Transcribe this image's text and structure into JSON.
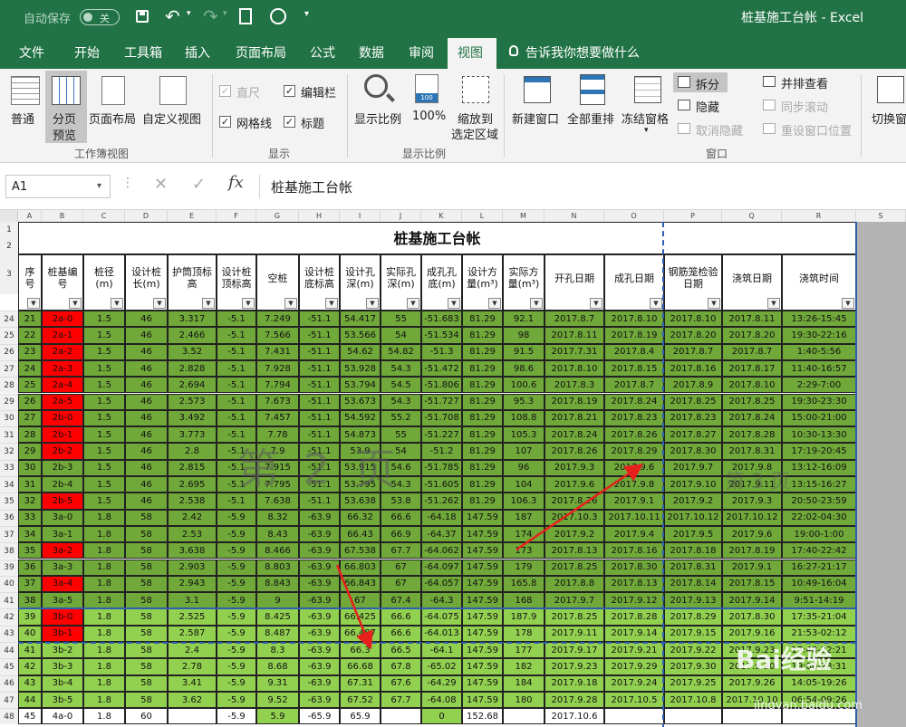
{
  "titlebar": {
    "autosave_label": "自动保存",
    "autosave_state": "关",
    "title": "桩基施工台帐 - Excel"
  },
  "tabs": [
    "文件",
    "开始",
    "工具箱",
    "插入",
    "页面布局",
    "公式",
    "数据",
    "审阅",
    "视图"
  ],
  "tell_me": "告诉我你想要做什么",
  "ribbon": {
    "normal": "普通",
    "page_break_1": "分页",
    "page_break_2": "预览",
    "page_layout": "页面布局",
    "custom_view": "自定义视图",
    "group_workbook_views": "工作簿视图",
    "ruler": "直尺",
    "formula_bar": "编辑栏",
    "gridlines": "网格线",
    "headings": "标题",
    "group_show": "显示",
    "zoom": "显示比例",
    "zoom100": "100%",
    "zoom_sel_1": "缩放到",
    "zoom_sel_2": "选定区域",
    "group_zoom": "显示比例",
    "new_window": "新建窗口",
    "arrange_all": "全部重排",
    "freeze": "冻结窗格",
    "split": "拆分",
    "hide": "隐藏",
    "unhide": "取消隐藏",
    "side_by_side": "并排查看",
    "sync_scroll": "同步滚动",
    "reset_pos": "重设窗口位置",
    "group_window": "窗口",
    "switch": "切换窗"
  },
  "formula": {
    "name_box": "A1",
    "content": "桩基施工台帐"
  },
  "colors": {
    "brand": "#217346",
    "dark_green": "#70a83a",
    "light_green": "#92d050",
    "red": "#ff0000"
  },
  "columns": [
    "A",
    "B",
    "C",
    "D",
    "E",
    "F",
    "G",
    "H",
    "I",
    "J",
    "K",
    "L",
    "M",
    "N",
    "O",
    "P",
    "Q",
    "R",
    "S"
  ],
  "sheet": {
    "title": "桩基施工台帐",
    "headers": [
      "序号",
      "桩基编号",
      "桩径(m)",
      "设计桩长(m)",
      "护筒顶标高",
      "设计桩顶标高",
      "空桩",
      "设计桩底标高",
      "设计孔深(m)",
      "实际孔深(m)",
      "成孔孔底(m)",
      "设计方量(m³)",
      "实际方量(m³)",
      "开孔日期",
      "成孔日期",
      "钢筋笼检验日期",
      "浇筑日期",
      "浇筑时间"
    ],
    "watermark_1": "第 2 页",
    "watermark_2": "第 3 页",
    "header_row_nums": [
      "1",
      "2",
      "3"
    ],
    "rows": [
      {
        "n": "24",
        "c": [
          "21",
          "2a-0",
          "1.5",
          "46",
          "3.317",
          "-5.1",
          "7.249",
          "-51.1",
          "54.417",
          "55",
          "-51.683",
          "81.29",
          "92.1",
          "2017.8.7",
          "2017.8.10",
          "2017.8.10",
          "2017.8.11",
          "13:26-15:45"
        ]
      },
      {
        "n": "25",
        "c": [
          "22",
          "2a-1",
          "1.5",
          "46",
          "2.466",
          "-5.1",
          "7.566",
          "-51.1",
          "53.566",
          "54",
          "-51.534",
          "81.29",
          "98",
          "2017.8.11",
          "2017.8.19",
          "2017.8.20",
          "2017.8.20",
          "19:30-22:16"
        ]
      },
      {
        "n": "26",
        "c": [
          "23",
          "2a-2",
          "1.5",
          "46",
          "3.52",
          "-5.1",
          "7.431",
          "-51.1",
          "54.62",
          "54.82",
          "-51.3",
          "81.29",
          "91.5",
          "2017.7.31",
          "2017.8.4",
          "2017.8.7",
          "2017.8.7",
          "1:40-5:56"
        ]
      },
      {
        "n": "27",
        "c": [
          "24",
          "2a-3",
          "1.5",
          "46",
          "2.828",
          "-5.1",
          "7.928",
          "-51.1",
          "53.928",
          "54.3",
          "-51.472",
          "81.29",
          "98.6",
          "2017.8.10",
          "2017.8.15",
          "2017.8.16",
          "2017.8.17",
          "11:40-16:57"
        ]
      },
      {
        "n": "28",
        "c": [
          "25",
          "2a-4",
          "1.5",
          "46",
          "2.694",
          "-5.1",
          "7.794",
          "-51.1",
          "53.794",
          "54.5",
          "-51.806",
          "81.29",
          "100.6",
          "2017.8.3",
          "2017.8.7",
          "2017.8.9",
          "2017.8.10",
          "2:29-7:00"
        ]
      },
      {
        "n": "29",
        "c": [
          "26",
          "2a-5",
          "1.5",
          "46",
          "2.573",
          "-5.1",
          "7.673",
          "-51.1",
          "53.673",
          "54.3",
          "-51.727",
          "81.29",
          "95.3",
          "2017.8.19",
          "2017.8.24",
          "2017.8.25",
          "2017.8.25",
          "19:30-23:30"
        ]
      },
      {
        "n": "30",
        "c": [
          "27",
          "2b-0",
          "1.5",
          "46",
          "3.492",
          "-5.1",
          "7.457",
          "-51.1",
          "54.592",
          "55.2",
          "-51.708",
          "81.29",
          "108.8",
          "2017.8.21",
          "2017.8.23",
          "2017.8.23",
          "2017.8.24",
          "15:00-21:00"
        ]
      },
      {
        "n": "31",
        "c": [
          "28",
          "2b-1",
          "1.5",
          "46",
          "3.773",
          "-5.1",
          "7.78",
          "-51.1",
          "54.873",
          "55",
          "-51.227",
          "81.29",
          "105.3",
          "2017.8.24",
          "2017.8.26",
          "2017.8.27",
          "2017.8.28",
          "10:30-13:30"
        ]
      },
      {
        "n": "32",
        "c": [
          "29",
          "2b-2",
          "1.5",
          "46",
          "2.8",
          "-5.1",
          "7.9",
          "-51.1",
          "53.9",
          "54",
          "-51.2",
          "81.29",
          "107",
          "2017.8.26",
          "2017.8.29",
          "2017.8.30",
          "2017.8.31",
          "17:19-20:45"
        ]
      },
      {
        "n": "33",
        "c": [
          "30",
          "2b-3",
          "1.5",
          "46",
          "2.815",
          "-5.1",
          "7.915",
          "-51.1",
          "53.915",
          "54.6",
          "-51.785",
          "81.29",
          "96",
          "2017.9.3",
          "2017.9.6",
          "2017.9.7",
          "2017.9.8",
          "13:12-16:09"
        ]
      },
      {
        "n": "34",
        "c": [
          "31",
          "2b-4",
          "1.5",
          "46",
          "2.695",
          "-5.1",
          "7.795",
          "-51.1",
          "53.795",
          "54.3",
          "-51.605",
          "81.29",
          "104",
          "2017.9.6",
          "2017.9.8",
          "2017.9.10",
          "2017.9.11",
          "13:15-16:27"
        ]
      },
      {
        "n": "35",
        "c": [
          "32",
          "2b-5",
          "1.5",
          "46",
          "2.538",
          "-5.1",
          "7.638",
          "-51.1",
          "53.638",
          "53.8",
          "-51.262",
          "81.29",
          "106.3",
          "2017.8.26",
          "2017.9.1",
          "2017.9.2",
          "2017.9.3",
          "20:50-23:59"
        ]
      },
      {
        "n": "36",
        "c": [
          "33",
          "3a-0",
          "1.8",
          "58",
          "2.42",
          "-5.9",
          "8.32",
          "-63.9",
          "66.32",
          "66.6",
          "-64.18",
          "147.59",
          "187",
          "2017.10.3",
          "2017.10.11",
          "2017.10.12",
          "2017.10.12",
          "22:02-04:30"
        ]
      },
      {
        "n": "37",
        "c": [
          "34",
          "3a-1",
          "1.8",
          "58",
          "2.53",
          "-5.9",
          "8.43",
          "-63.9",
          "66.43",
          "66.9",
          "-64.37",
          "147.59",
          "174",
          "2017.9.2",
          "2017.9.4",
          "2017.9.5",
          "2017.9.6",
          "19:00-1:00"
        ]
      },
      {
        "n": "38",
        "c": [
          "35",
          "3a-2",
          "1.8",
          "58",
          "3.638",
          "-5.9",
          "8.466",
          "-63.9",
          "67.538",
          "67.7",
          "-64.062",
          "147.59",
          "173",
          "2017.8.13",
          "2017.8.16",
          "2017.8.18",
          "2017.8.19",
          "17:40-22:42"
        ]
      },
      {
        "n": "39",
        "c": [
          "36",
          "3a-3",
          "1.8",
          "58",
          "2.903",
          "-5.9",
          "8.803",
          "-63.9",
          "66.803",
          "67",
          "-64.097",
          "147.59",
          "179",
          "2017.8.25",
          "2017.8.30",
          "2017.8.31",
          "2017.9.1",
          "16:27-21:17"
        ]
      },
      {
        "n": "40",
        "c": [
          "37",
          "3a-4",
          "1.8",
          "58",
          "2.943",
          "-5.9",
          "8.843",
          "-63.9",
          "66.843",
          "67",
          "-64.057",
          "147.59",
          "165.8",
          "2017.8.8",
          "2017.8.13",
          "2017.8.14",
          "2017.8.15",
          "10:49-16:04"
        ]
      },
      {
        "n": "41",
        "c": [
          "38",
          "3a-5",
          "1.8",
          "58",
          "3.1",
          "-5.9",
          "9",
          "-63.9",
          "67",
          "67.4",
          "-64.3",
          "147.59",
          "168",
          "2017.9.7",
          "2017.9.12",
          "2017.9.13",
          "2017.9.14",
          "9:51-14:19"
        ]
      },
      {
        "n": "42",
        "c": [
          "39",
          "3b-0",
          "1.8",
          "58",
          "2.525",
          "-5.9",
          "8.425",
          "-63.9",
          "66.425",
          "66.6",
          "-64.075",
          "147.59",
          "187.9",
          "2017.8.25",
          "2017.8.28",
          "2017.8.29",
          "2017.8.30",
          "17:35-21:04"
        ]
      },
      {
        "n": "43",
        "c": [
          "40",
          "3b-1",
          "1.8",
          "58",
          "2.587",
          "-5.9",
          "8.487",
          "-63.9",
          "66.487",
          "66.6",
          "-64.013",
          "147.59",
          "178",
          "2017.9.11",
          "2017.9.14",
          "2017.9.15",
          "2017.9.16",
          "21:53-02:12"
        ]
      },
      {
        "n": "44",
        "c": [
          "41",
          "3b-2",
          "1.8",
          "58",
          "2.4",
          "-5.9",
          "8.3",
          "-63.9",
          "66.3",
          "66.5",
          "-64.1",
          "147.59",
          "177",
          "2017.9.17",
          "2017.9.21",
          "2017.9.22",
          "2017.9.23",
          "17:48-22:21"
        ]
      },
      {
        "n": "45",
        "c": [
          "42",
          "3b-3",
          "1.8",
          "58",
          "2.78",
          "-5.9",
          "8.68",
          "-63.9",
          "66.68",
          "67.8",
          "-65.02",
          "147.59",
          "182",
          "2017.9.23",
          "2017.9.29",
          "2017.9.30",
          "2017.9.30",
          "19:00-23:31"
        ]
      },
      {
        "n": "46",
        "c": [
          "43",
          "3b-4",
          "1.8",
          "58",
          "3.41",
          "-5.9",
          "9.31",
          "-63.9",
          "67.31",
          "67.6",
          "-64.29",
          "147.59",
          "184",
          "2017.9.18",
          "2017.9.24",
          "2017.9.25",
          "2017.9.26",
          "14:05-19:26"
        ]
      },
      {
        "n": "47",
        "c": [
          "44",
          "3b-5",
          "1.8",
          "58",
          "3.62",
          "-5.9",
          "9.52",
          "-63.9",
          "67.52",
          "67.7",
          "-64.08",
          "147.59",
          "180",
          "2017.9.28",
          "2017.10.5",
          "2017.10.8",
          "2017.10.10",
          "06:54-09:26"
        ]
      },
      {
        "n": "48",
        "c": [
          "45",
          "4a-0",
          "1.8",
          "60",
          "",
          "-5.9",
          "5.9",
          "-65.9",
          "65.9",
          "",
          "0",
          "152.68",
          "",
          "2017.10.6",
          "",
          "",
          "",
          ""
        ]
      }
    ]
  },
  "watermark": {
    "baidu": "Bai经验",
    "url": "jingyan.baidu.com"
  }
}
